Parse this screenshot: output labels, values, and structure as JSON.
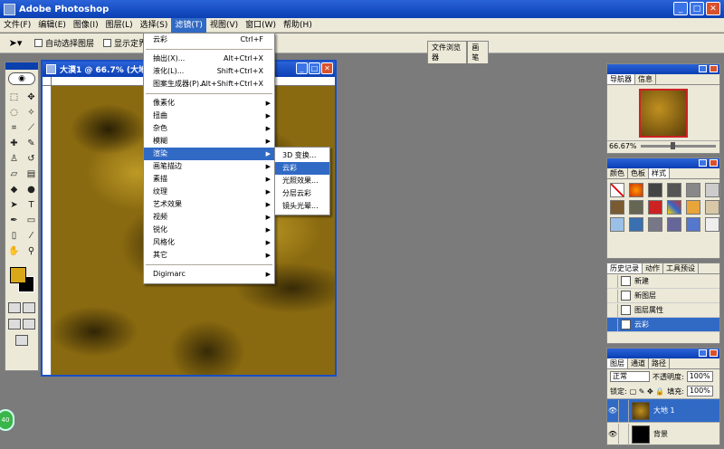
{
  "app": {
    "title": "Adobe Photoshop"
  },
  "menubar": {
    "items": [
      "文件(F)",
      "编辑(E)",
      "图像(I)",
      "图层(L)",
      "选择(S)",
      "滤镜(T)",
      "视图(V)",
      "窗口(W)",
      "帮助(H)"
    ]
  },
  "options": {
    "auto_select": "自动选择图层",
    "show_bounds": "显示定界框"
  },
  "palette_well": {
    "tabs": [
      "文件浏览器",
      "画笔"
    ]
  },
  "document": {
    "title": "大漠1 @ 66.7% (大地 1, RGB)"
  },
  "filter_menu": {
    "items": [
      {
        "label": "云彩",
        "shortcut": "Ctrl+F"
      },
      {
        "label": "抽出(X)...",
        "shortcut": "Alt+Ctrl+X"
      },
      {
        "label": "液化(L)...",
        "shortcut": "Shift+Ctrl+X"
      },
      {
        "label": "图案生成器(P)...",
        "shortcut": "Alt+Shift+Ctrl+X"
      },
      {
        "label": "像素化"
      },
      {
        "label": "扭曲"
      },
      {
        "label": "杂色"
      },
      {
        "label": "模糊"
      },
      {
        "label": "渲染"
      },
      {
        "label": "画笔描边"
      },
      {
        "label": "素描"
      },
      {
        "label": "纹理"
      },
      {
        "label": "艺术效果"
      },
      {
        "label": "视频"
      },
      {
        "label": "锐化"
      },
      {
        "label": "风格化"
      },
      {
        "label": "其它"
      },
      {
        "label": "Digimarc"
      }
    ]
  },
  "render_submenu": {
    "items": [
      "3D 变换...",
      "云彩",
      "光照效果...",
      "分层云彩",
      "镜头光晕..."
    ]
  },
  "navigator": {
    "tabs": [
      "导航器",
      "信息"
    ],
    "zoom": "66.67%"
  },
  "styles": {
    "tabs": [
      "颜色",
      "色板",
      "样式"
    ]
  },
  "history": {
    "tabs": [
      "历史记录",
      "动作",
      "工具预设"
    ],
    "items": [
      "新建",
      "新图层",
      "图层属性",
      "云彩"
    ]
  },
  "layers": {
    "tabs": [
      "图层",
      "通道",
      "路径"
    ],
    "blend_mode": "正常",
    "opacity_label": "不透明度:",
    "opacity": "100%",
    "lock_label": "锁定:",
    "fill_label": "填充:",
    "fill": "100%",
    "items": [
      {
        "name": "大地 1"
      },
      {
        "name": "背景"
      }
    ]
  },
  "badge": "40"
}
